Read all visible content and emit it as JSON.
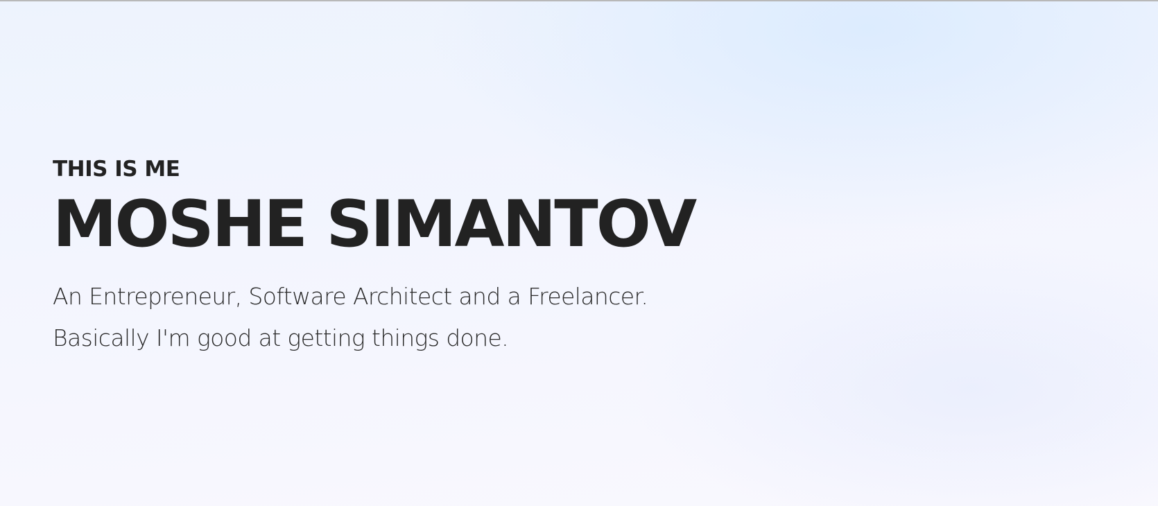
{
  "hero": {
    "kicker": "THIS IS ME",
    "name": "MOSHE SIMANTOV",
    "tagline_line1": "An Entrepreneur, Software Architect and a Freelancer.",
    "tagline_line2": "Basically I'm good at getting things done."
  },
  "colors": {
    "text": "#222222",
    "background_top": "#edf3fd",
    "background_bottom": "#f9f8fe"
  }
}
